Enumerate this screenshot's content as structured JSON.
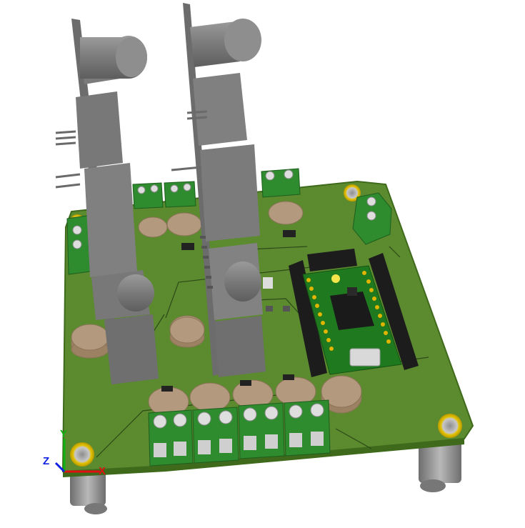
{
  "view": {
    "background": "#ffffff",
    "pcb_color": "#5b8a2f",
    "pcb_edge_color": "#3f6a1c",
    "connector_color": "#2e8b2e",
    "capacitor_color": "#b39a7f",
    "part_gray": "#8a8a8a",
    "mcu_board_color": "#1f7a1f"
  },
  "axes": {
    "x_label": "X",
    "y_label": "Y",
    "z_label": "Z",
    "x_color": "#e01010",
    "y_color": "#10b010",
    "z_color": "#1020e0"
  }
}
